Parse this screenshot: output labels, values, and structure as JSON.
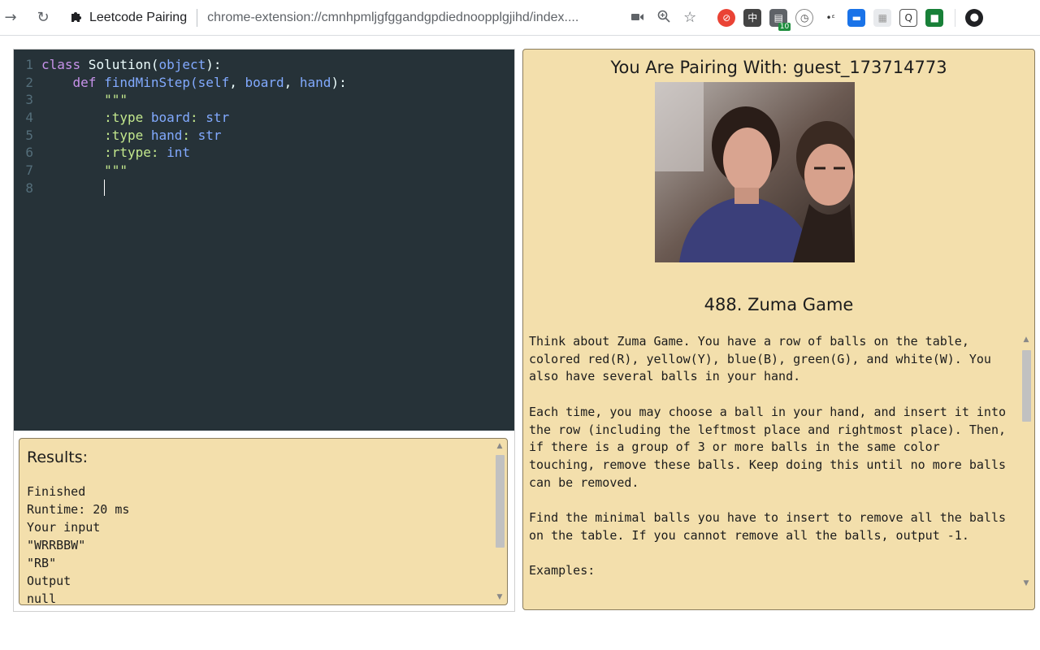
{
  "browser": {
    "site_name": "Leetcode Pairing",
    "url": "chrome-extension://cmnhpmljgfggandgpdiednoopplgjihd/index....",
    "extension_badge": "10"
  },
  "editor": {
    "line_numbers": [
      "1",
      "2",
      "3",
      "4",
      "5",
      "6",
      "7",
      "8"
    ],
    "line1": {
      "kw": "class",
      "name": " Solution(",
      "base": "object",
      "end": "):"
    },
    "line2": {
      "indent": "    ",
      "kw": "def",
      "name": " findMinStep(",
      "p1": "self",
      "c1": ", ",
      "p2": "board",
      "c2": ", ",
      "p3": "hand",
      "end": "):"
    },
    "line3": "        \"\"\"",
    "line4": {
      "indent": "        ",
      "a": ":type ",
      "b": "board",
      "c": ": ",
      "d": "str"
    },
    "line5": {
      "indent": "        ",
      "a": ":type ",
      "b": "hand",
      "c": ": ",
      "d": "str"
    },
    "line6": {
      "indent": "        ",
      "a": ":rtype",
      "c": ": ",
      "d": "int"
    },
    "line7": "        \"\"\"",
    "line8": "        "
  },
  "results": {
    "title": "Results:",
    "lines": [
      "Finished",
      "Runtime: 20 ms",
      "Your input",
      "\"WRRBBW\"",
      "\"RB\"",
      "Output",
      "null"
    ]
  },
  "pairing": {
    "title": "You Are Pairing With: guest_173714773"
  },
  "problem": {
    "title": "488. Zuma Game",
    "paragraphs": [
      "Think about Zuma Game. You have a row of balls on the table, colored red(R), yellow(Y), blue(B), green(G), and white(W). You also have several balls in your hand.",
      "Each time, you may choose a ball in your hand, and insert it into the row (including the leftmost place and rightmost place). Then, if there is a group of 3 or more balls in the same color touching, remove these balls. Keep doing this until no more balls can be removed.",
      "Find the minimal balls you have to insert to remove all the balls on the table. If you cannot remove all the balls, output -1.",
      "Examples:"
    ]
  },
  "colors": {
    "editor_bg": "#263238",
    "panel_bg": "#f3dfac",
    "keyword": "#c792ea",
    "function": "#82aaff",
    "string": "#c3e88d"
  },
  "icons": [
    "forward-icon",
    "reload-icon",
    "puzzle-icon",
    "camera-icon",
    "zoom-icon",
    "star-icon",
    "profile-icon"
  ]
}
